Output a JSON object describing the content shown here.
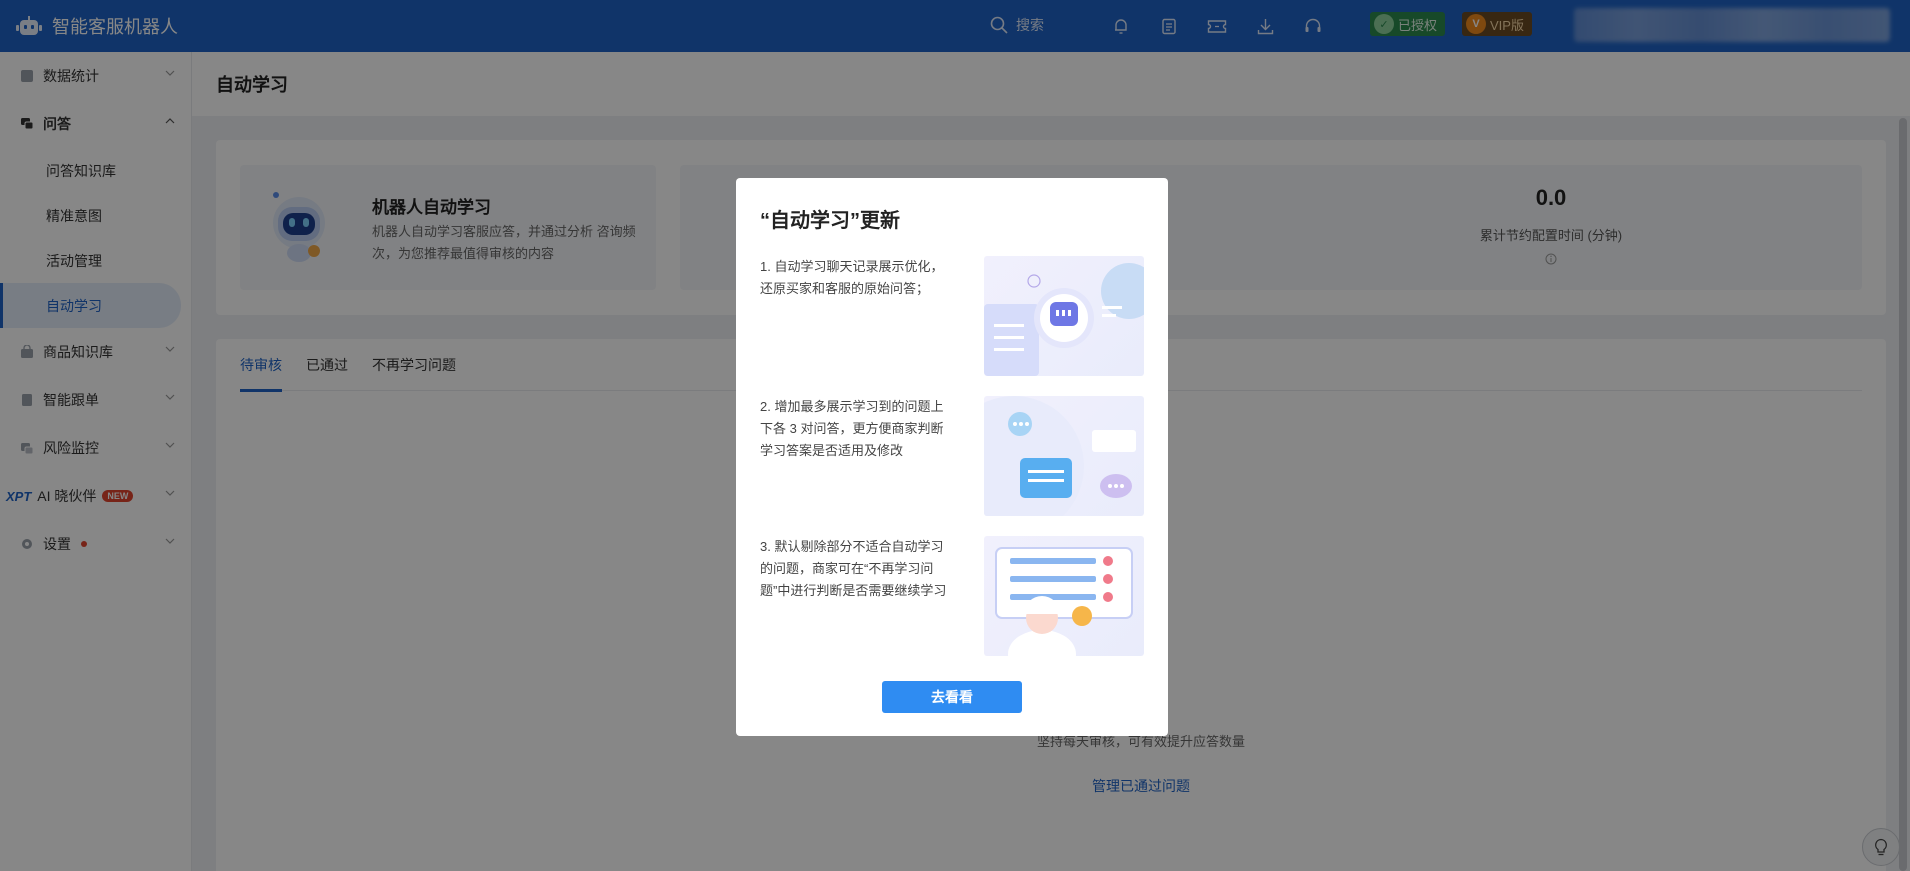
{
  "app": {
    "title": "智能客服机器人"
  },
  "topbar": {
    "search_label": "搜索",
    "authorized_label": "已授权",
    "vip_label": "VIP版",
    "icons": [
      "bell-icon",
      "document-icon",
      "ticket-icon",
      "download-icon",
      "headset-icon"
    ]
  },
  "sidebar": {
    "items": [
      {
        "label": "数据统计"
      },
      {
        "label": "问答",
        "children": [
          "问答知识库",
          "精准意图",
          "活动管理",
          "自动学习"
        ]
      },
      {
        "label": "商品知识库"
      },
      {
        "label": "智能跟单"
      },
      {
        "label": "风险监控"
      },
      {
        "prefix": "XPT",
        "label": "AI 晓伙伴",
        "badge": "NEW"
      },
      {
        "label": "设置"
      }
    ]
  },
  "page": {
    "title": "自动学习",
    "robot_card": {
      "title": "机器人自动学习",
      "description": "机器人自动学习客服应答，并通过分析 咨询频次，为您推荐最值得审核的内容"
    },
    "stat_card": {
      "value": "0.0",
      "label": "累计节约配置时间 (分钟)"
    },
    "tabs": [
      "待审核",
      "已通过",
      "不再学习问题"
    ],
    "empty_text": "坚持每天审核，可有效提升应答数量",
    "empty_link": "管理已通过问题"
  },
  "modal": {
    "title": "“自动学习”更新",
    "features": [
      "1. 自动学习聊天记录展示优化，还原买家和客服的原始问答；",
      "2. 增加最多展示学习到的问题上下各 3 对问答，更方便商家判断学习答案是否适用及修改",
      "3. 默认剔除部分不适合自动学习的问题，商家可在“不再学习问题”中进行判断是否需要继续学习"
    ],
    "button_label": "去看看"
  },
  "colors": {
    "brand": "#1f63c6",
    "button": "#2f8cf2",
    "new_badge": "#e0452e"
  }
}
